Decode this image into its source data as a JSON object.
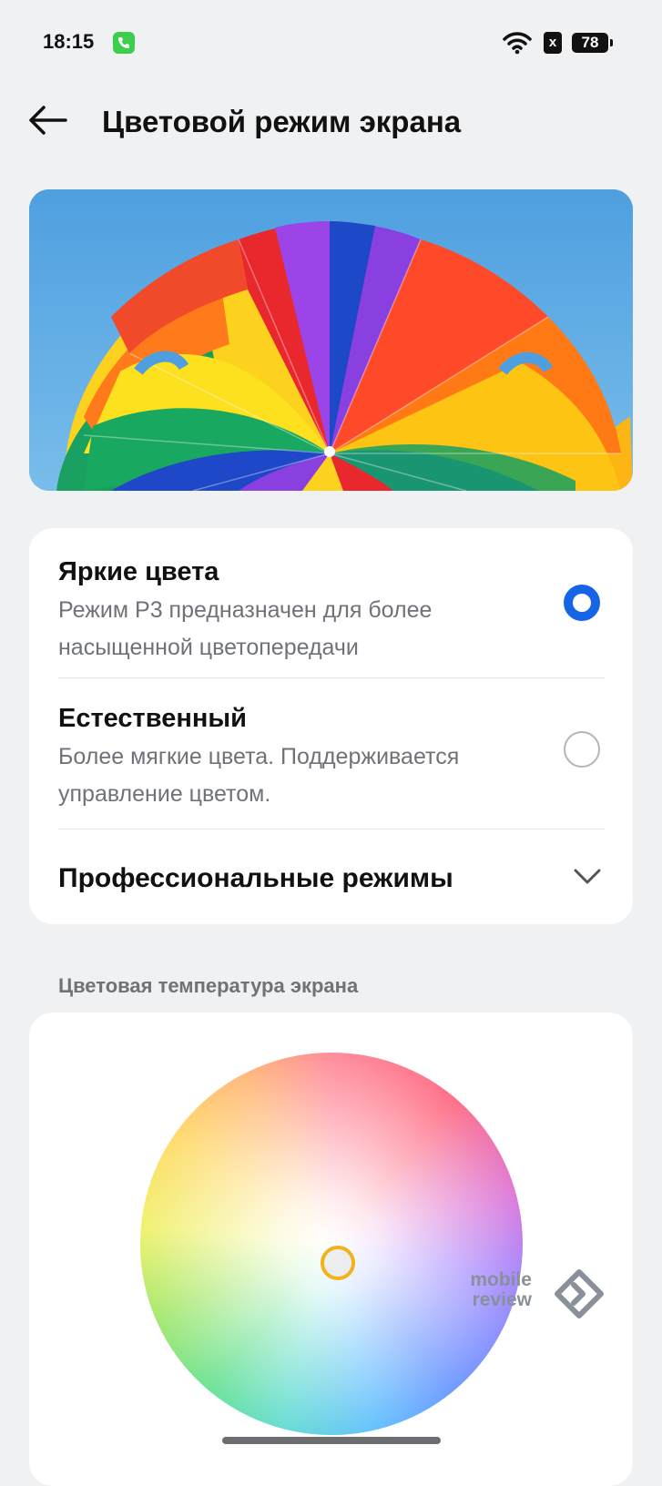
{
  "status_bar": {
    "time": "18:15",
    "battery": "78",
    "notification_icon": "x"
  },
  "header": {
    "title": "Цветовой режим экрана"
  },
  "modes": {
    "vivid": {
      "title": "Яркие цвета",
      "description": "Режим P3 предназначен для более насыщенной цветопередачи",
      "selected": true
    },
    "natural": {
      "title": "Естественный",
      "description": "Более мягкие цвета. Поддерживается управление цветом.",
      "selected": false
    },
    "pro": {
      "title": "Профессиональные режимы"
    }
  },
  "temperature": {
    "label": "Цветовая температура экрана"
  },
  "watermark": {
    "line1": "mobile",
    "line2": "review"
  },
  "colors": {
    "accent": "#1565e6",
    "handle": "#f2b21d",
    "background": "#f0f1f3"
  }
}
